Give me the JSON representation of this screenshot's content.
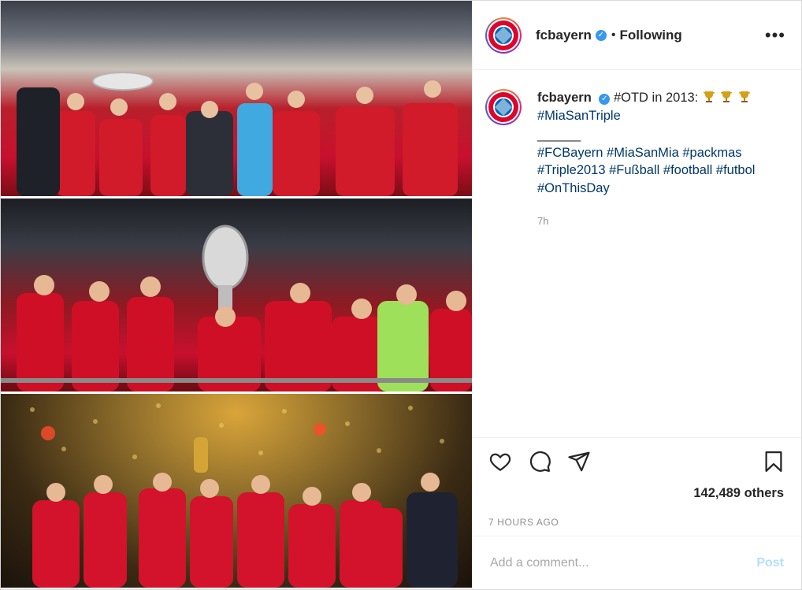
{
  "post": {
    "username": "fcbayern",
    "verified_icon": "verified-badge-icon",
    "separator": "•",
    "follow_status": "Following",
    "more_icon": "more-options-icon",
    "colors": {
      "club_red": "#dc052d",
      "link": "#00376b",
      "muted": "#8e8e8e"
    }
  },
  "caption": {
    "username": "fcbayern",
    "line1": "#OTD in 2013:",
    "trophy_icon": "trophy-icon",
    "hashtag1": "#MiaSanTriple",
    "divider": "______",
    "tags": [
      "#FCBayern",
      "#MiaSanMia",
      "#packmas",
      "#Triple2013",
      "#Fußball",
      "#football",
      "#futbol",
      "#OnThisDay"
    ],
    "age": "7h"
  },
  "actions": {
    "like_icon": "heart-icon",
    "comment_icon": "comment-icon",
    "share_icon": "share-icon",
    "save_icon": "bookmark-icon",
    "likes_text": "142,489 others",
    "timestamp": "7 HOURS AGO"
  },
  "comment": {
    "placeholder": "Add a comment...",
    "post_label": "Post"
  }
}
